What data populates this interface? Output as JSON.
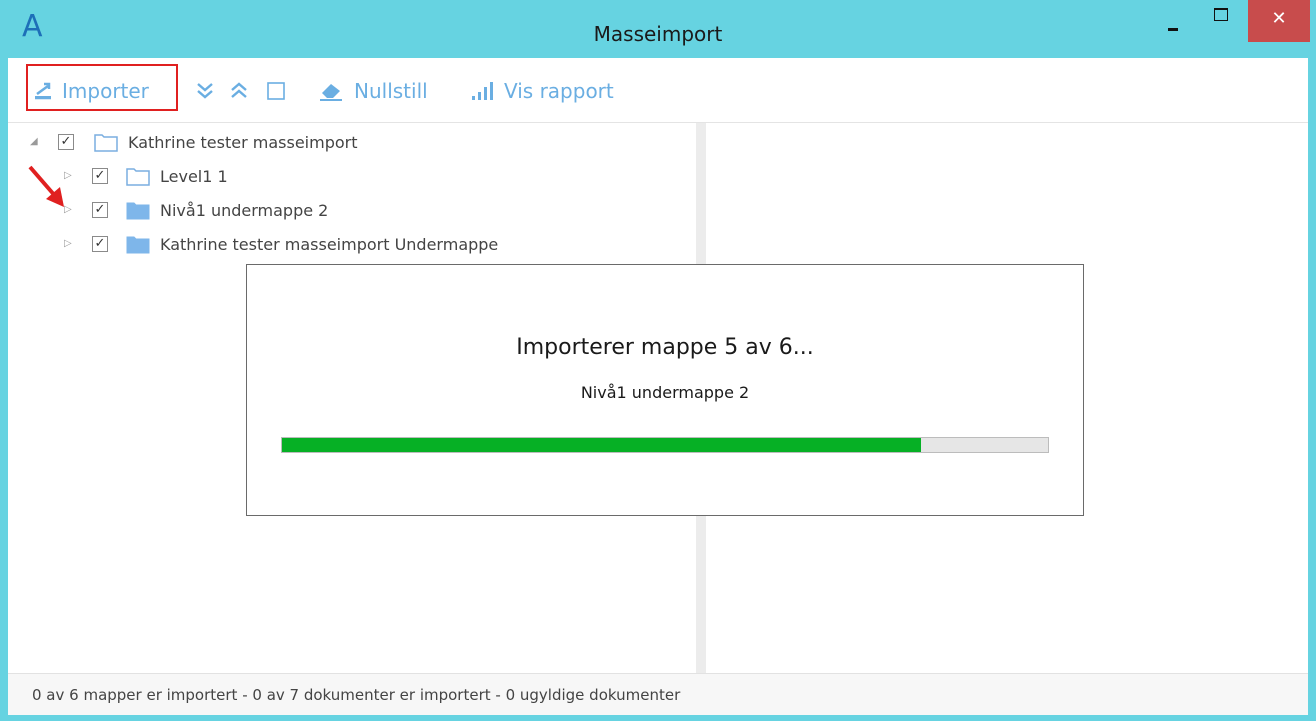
{
  "window": {
    "title": "Masseimport",
    "logo_text": "A",
    "close_glyph": "✕"
  },
  "toolbar": {
    "import_label": "Importer",
    "reset_label": "Nullstill",
    "report_label": "Vis rapport",
    "icons": [
      "import-icon",
      "expand-all-icon",
      "collapse-all-icon",
      "checkbox-icon",
      "eraser-icon",
      "bar-chart-icon"
    ]
  },
  "tree": {
    "items": [
      {
        "label": "Kathrine tester masseimport",
        "checked": true,
        "expanded": true,
        "folder": "empty"
      },
      {
        "label": "Level1 1",
        "checked": true,
        "expanded": false,
        "folder": "empty"
      },
      {
        "label": "Nivå1 undermappe 2",
        "checked": true,
        "expanded": false,
        "folder": "filled"
      },
      {
        "label": "Kathrine tester masseimport Undermappe",
        "checked": true,
        "expanded": false,
        "folder": "filled"
      }
    ]
  },
  "progress": {
    "title": "Importerer mappe 5 av 6...",
    "current": "Nivå1 undermappe 2",
    "fraction": 0.834
  },
  "status": {
    "text": "0 av 6 mapper er importert  -  0 av 7 dokumenter er importert  -  0 ugyldige dokumenter"
  },
  "colors": {
    "titlebar": "#66d3e1",
    "accent": "#6aaee2",
    "progress": "#06b025",
    "highlight": "#e02020",
    "close": "#c84c4c"
  }
}
